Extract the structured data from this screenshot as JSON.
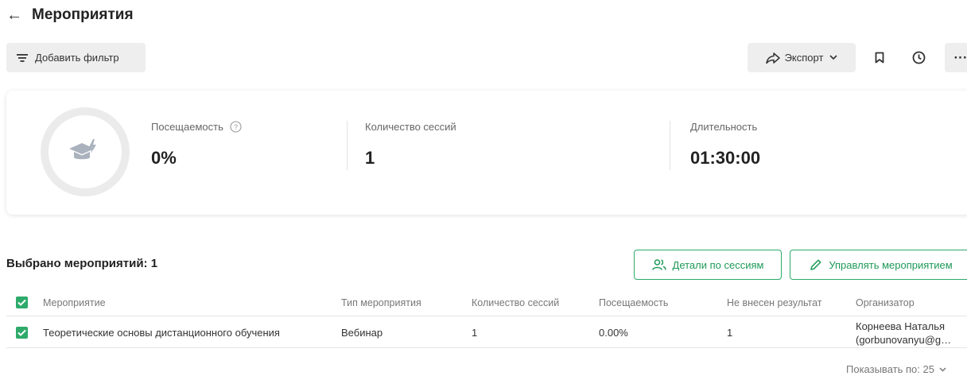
{
  "header": {
    "back_icon": "arrow-left-icon",
    "title": "Мероприятия"
  },
  "toolbar": {
    "filter_label": "Добавить фильтр",
    "export_label": "Экспорт",
    "more_label": "···"
  },
  "stats": {
    "attendance_label": "Посещаемость",
    "attendance_value": "0%",
    "sessions_label": "Количество сессий",
    "sessions_value": "1",
    "duration_label": "Длительность",
    "duration_value": "01:30:00"
  },
  "selection": {
    "label": "Выбрано мероприятий: 1",
    "details_label": "Детали по сессиям",
    "manage_label": "Управлять мероприятием"
  },
  "table": {
    "columns": [
      "Мероприятие",
      "Тип мероприятия",
      "Количество сессий",
      "Посещаемость",
      "Не внесен результат",
      "Организатор"
    ],
    "rows": [
      {
        "event": "Теоретические основы дистанционного обучения",
        "type": "Вебинар",
        "sessions": "1",
        "attendance": "0.00%",
        "no_result": "1",
        "organizer_line1": "Корнеева Наталья",
        "organizer_line2": "(gorbunovanyu@g…"
      }
    ]
  },
  "pagination": {
    "page_size_label": "Показывать по: 25"
  },
  "colors": {
    "accent": "#2eaa6a",
    "accent_text": "#1e9a58",
    "button_bg": "#eeeeee"
  }
}
